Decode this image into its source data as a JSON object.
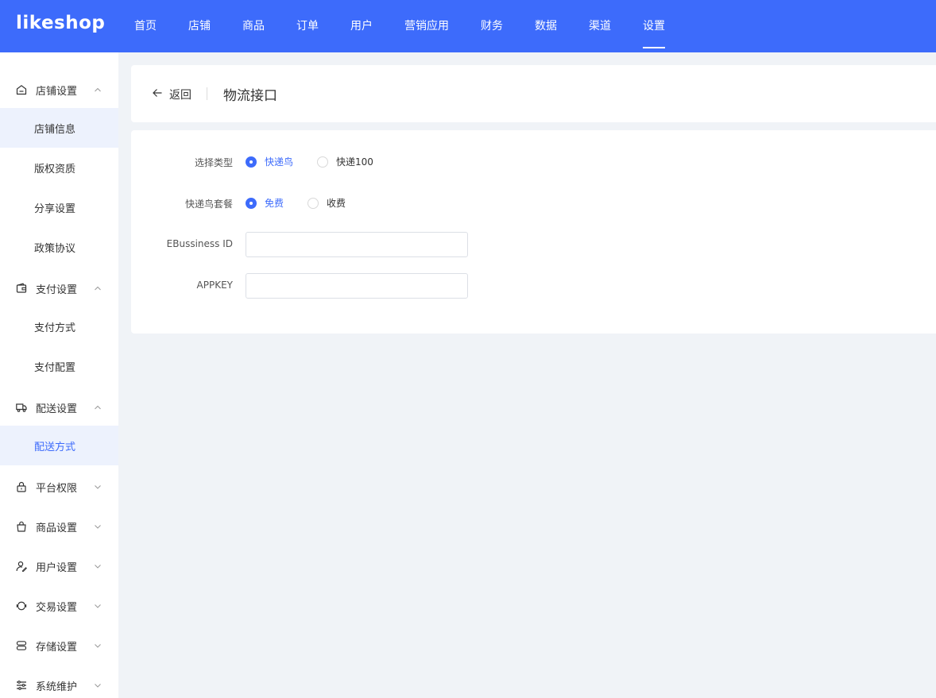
{
  "brand": {
    "logo_text": "likeshop",
    "accent_color": "#3d6bfb"
  },
  "topnav": {
    "items": [
      {
        "label": "首页"
      },
      {
        "label": "店铺"
      },
      {
        "label": "商品"
      },
      {
        "label": "订单"
      },
      {
        "label": "用户"
      },
      {
        "label": "营销应用"
      },
      {
        "label": "财务"
      },
      {
        "label": "数据"
      },
      {
        "label": "渠道"
      },
      {
        "label": "设置",
        "active": true
      }
    ]
  },
  "sidebar": {
    "groups": [
      {
        "label": "店铺设置",
        "icon": "store-icon",
        "expanded": true,
        "items": [
          {
            "label": "店铺信息"
          },
          {
            "label": "版权资质"
          },
          {
            "label": "分享设置"
          },
          {
            "label": "政策协议"
          }
        ]
      },
      {
        "label": "支付设置",
        "icon": "wallet-icon",
        "expanded": true,
        "items": [
          {
            "label": "支付方式"
          },
          {
            "label": "支付配置"
          }
        ]
      },
      {
        "label": "配送设置",
        "icon": "truck-icon",
        "expanded": true,
        "items": [
          {
            "label": "配送方式",
            "active": true
          }
        ]
      },
      {
        "label": "平台权限",
        "icon": "lock-icon",
        "expanded": false
      },
      {
        "label": "商品设置",
        "icon": "shopping-bag-icon",
        "expanded": false
      },
      {
        "label": "用户设置",
        "icon": "user-edit-icon",
        "expanded": false
      },
      {
        "label": "交易设置",
        "icon": "exchange-icon",
        "expanded": false
      },
      {
        "label": "存储设置",
        "icon": "storage-icon",
        "expanded": false
      },
      {
        "label": "系统维护",
        "icon": "settings-list-icon",
        "expanded": false
      }
    ]
  },
  "header": {
    "back_label": "返回",
    "title": "物流接口"
  },
  "form": {
    "type": {
      "label": "选择类型",
      "options": [
        "快递鸟",
        "快递100"
      ],
      "selected": "快递鸟"
    },
    "package": {
      "label": "快递鸟套餐",
      "options": [
        "免费",
        "收费"
      ],
      "selected": "免费"
    },
    "ebusiness_id": {
      "label": "EBussiness ID",
      "value": ""
    },
    "appkey": {
      "label": "APPKEY",
      "value": ""
    }
  }
}
